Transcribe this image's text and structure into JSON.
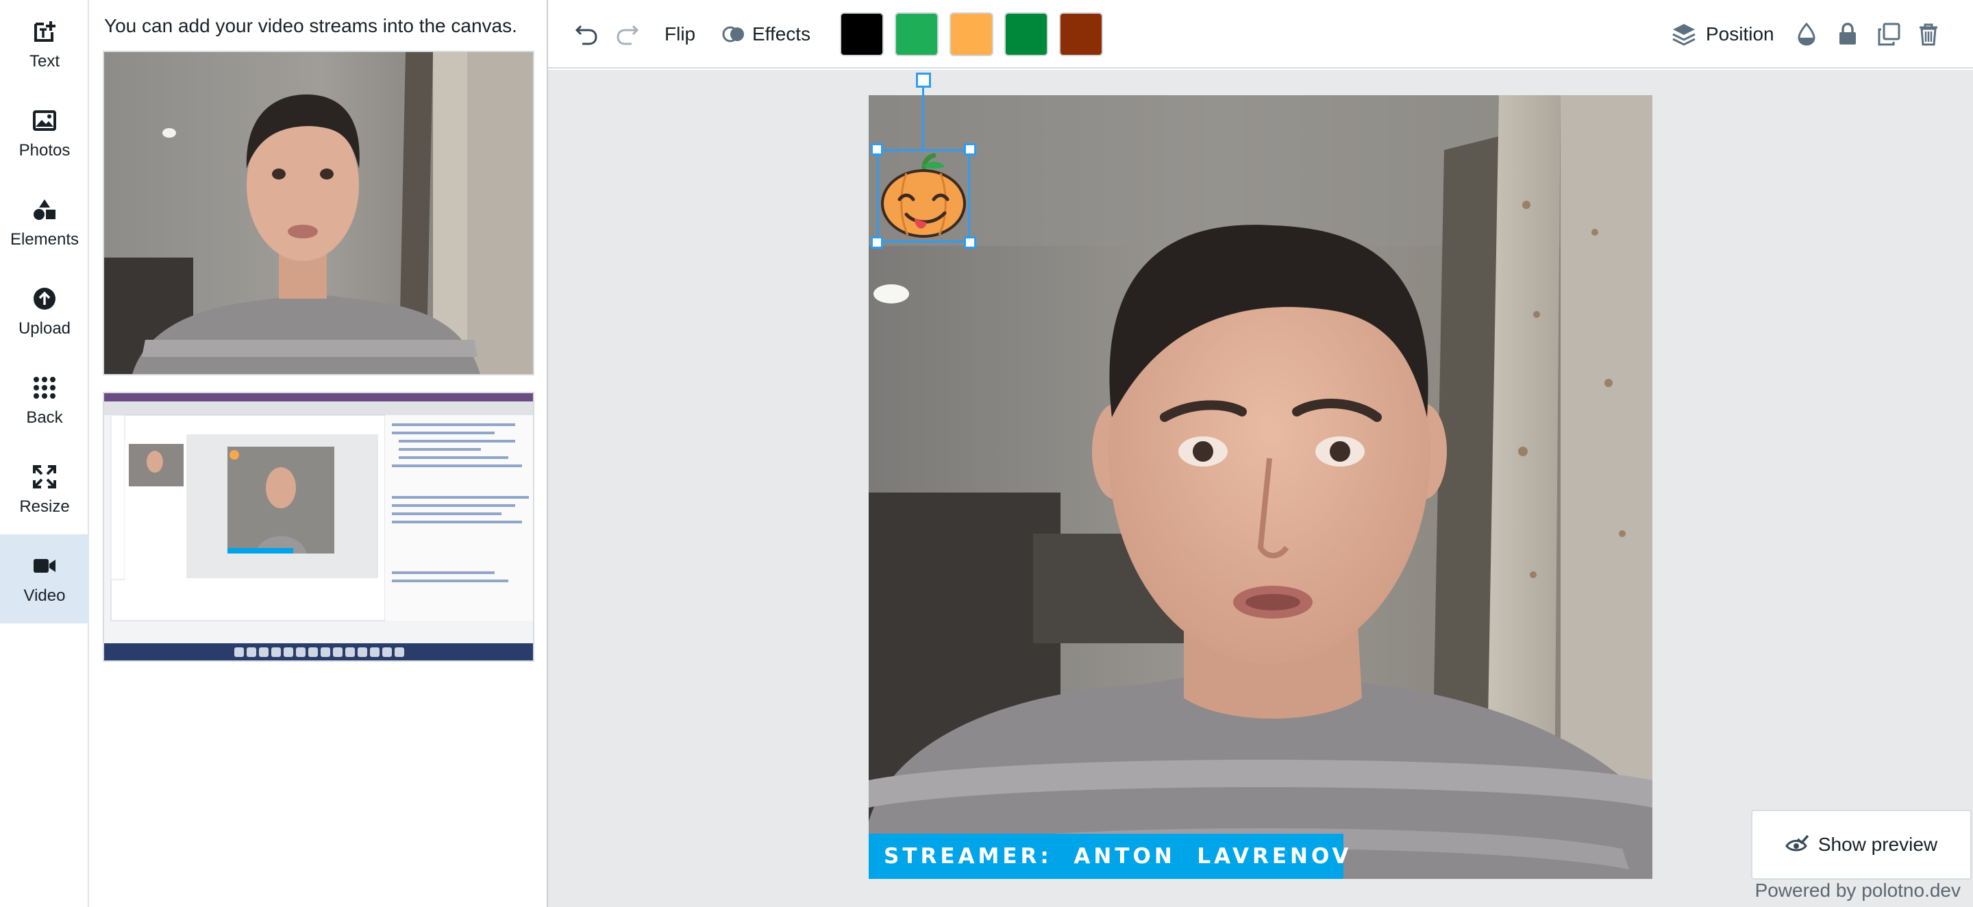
{
  "sidebar": {
    "tabs": [
      {
        "label": "Text",
        "icon": "text-add-icon"
      },
      {
        "label": "Photos",
        "icon": "photo-icon"
      },
      {
        "label": "Elements",
        "icon": "shapes-icon"
      },
      {
        "label": "Upload",
        "icon": "upload-icon"
      },
      {
        "label": "Back",
        "icon": "grid-dots-icon"
      },
      {
        "label": "Resize",
        "icon": "resize-icon"
      },
      {
        "label": "Video",
        "icon": "video-camera-icon",
        "active": true
      }
    ]
  },
  "panel": {
    "hint": "You can add your video streams into the canvas.",
    "streams": [
      {
        "name": "Webcam stream"
      },
      {
        "name": "Screen share stream"
      }
    ]
  },
  "toolbar": {
    "undo_icon": "undo-icon",
    "redo_icon": "redo-icon",
    "flip_label": "Flip",
    "effects_label": "Effects",
    "colors": [
      "#000000",
      "#1fae58",
      "#ffae4c",
      "#00883a",
      "#8c2e05"
    ],
    "position_label": "Position"
  },
  "canvas": {
    "streamer_label": "STREAMER:  ANTON  LAVRENOV",
    "sticker": "pumpkin-emoji"
  },
  "footer": {
    "preview_label": "Show preview",
    "credit": "Powered by polotno.dev"
  }
}
